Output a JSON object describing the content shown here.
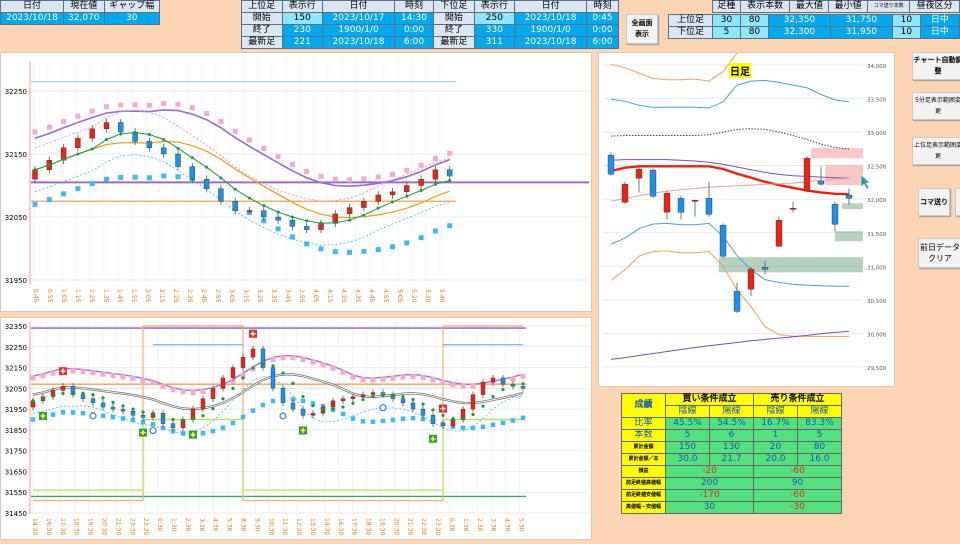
{
  "summary": {
    "headers": [
      "日付",
      "現在値",
      "ギャップ幅"
    ],
    "values": [
      "2023/10/18",
      "32,070",
      "30"
    ]
  },
  "range_table": {
    "headers": [
      "上位足",
      "表示行",
      "日付",
      "時刻",
      "下位足",
      "表示行",
      "日付",
      "時刻"
    ],
    "rows": [
      [
        "開始",
        "150",
        "2023/10/17",
        "14:30",
        "開始",
        "250",
        "2023/10/18",
        "0:45"
      ],
      [
        "終了",
        "230",
        "1900/1/0",
        "0:00",
        "終了",
        "330",
        "1900/1/0",
        "0:00"
      ],
      [
        "最新足",
        "221",
        "2023/10/18",
        "6:00",
        "最新足",
        "311",
        "2023/10/18",
        "6:00"
      ]
    ]
  },
  "fullscreen_button": [
    "全画面",
    "表示"
  ],
  "timeframe_table": {
    "headers": [
      "",
      "足種",
      "表示本数",
      "最大値",
      "最小値",
      "コマ送り本数",
      "昼夜区分"
    ],
    "rows": [
      [
        "上位足",
        "30",
        "80",
        "32,350",
        "31,750",
        "10",
        "日中"
      ],
      [
        "下位足",
        "5",
        "80",
        "32,300",
        "31,950",
        "10",
        "日中"
      ]
    ]
  },
  "buttons": {
    "auto_adjust": "チャート自動調整",
    "lower_range": "5分足表示範囲変更",
    "upper_range": "上位足表示範囲変更",
    "step": "コマ送り",
    "clear_line1": "前日データ",
    "clear_line2": "クリア"
  },
  "stats": {
    "title": "成績",
    "buy_header": "買い条件成立",
    "sell_header": "売り条件成立",
    "sub": [
      "陰線",
      "陽線",
      "陰線",
      "陽線"
    ],
    "rows": [
      {
        "label": "比率",
        "cells": [
          "45.5%",
          "54.5%",
          "16.7%",
          "83.3%"
        ]
      },
      {
        "label": "本数",
        "cells": [
          "5",
          "6",
          "1",
          "5"
        ]
      },
      {
        "label": "累計金額",
        "cells": [
          "150",
          "130",
          "20",
          "80"
        ]
      },
      {
        "label": "累計金額／本",
        "cells": [
          "30.0",
          "21.7",
          "20.0",
          "16.0"
        ]
      }
    ],
    "merged_rows": [
      {
        "label": "損益",
        "buy": "-20",
        "sell": "-60"
      },
      {
        "label": "前足終値高値幅",
        "buy": "200",
        "sell": "90"
      },
      {
        "label": "前足終値安値幅",
        "buy": "-170",
        "sell": "-60"
      },
      {
        "label": "高値幅－安値幅",
        "buy": "30",
        "sell": "-30"
      }
    ]
  },
  "colors": {
    "up": "#e8231a",
    "down": "#1e90e6",
    "peach": "#fcd5b4",
    "accent_blue": "#00a8ee"
  },
  "chart_data": [
    {
      "type": "candlestick",
      "name": "5min-zoomed",
      "yticks": [
        "32250",
        "32150",
        "32050",
        "31950"
      ],
      "ylim": [
        31950,
        32250
      ],
      "xticks": [
        "0:45",
        "0:55",
        "1:05",
        "1:15",
        "1:25",
        "1:35",
        "1:45",
        "1:55",
        "2:05",
        "2:15",
        "2:25",
        "2:35",
        "2:45",
        "2:55",
        "3:05",
        "3:15",
        "3:25",
        "3:35",
        "3:45",
        "3:55",
        "4:05",
        "4:15",
        "4:25",
        "4:35",
        "4:45",
        "4:55",
        "5:05",
        "5:20",
        "5:30",
        "5:40"
      ],
      "first_open": 32110,
      "closes": [
        32125,
        32140,
        32160,
        32175,
        32190,
        32200,
        32185,
        32170,
        32160,
        32150,
        32130,
        32110,
        32095,
        32075,
        32060,
        32060,
        32050,
        32045,
        32035,
        32030,
        32040,
        32055,
        32065,
        32075,
        32085,
        32090,
        32100,
        32110,
        32125,
        32115
      ],
      "wick": 10,
      "band_upper_offset": 60,
      "band_lower_offset": 55,
      "hlines": [
        {
          "price": 32265,
          "color": "#9ccaf0"
        },
        {
          "price": 32105,
          "color": "#9a6cc8"
        },
        {
          "price": 32075,
          "color": "#f0a050"
        }
      ]
    },
    {
      "type": "candlestick",
      "name": "5min-full",
      "yticks": [
        "32350",
        "32250",
        "32150",
        "32050",
        "31950",
        "31850",
        "31750",
        "31650",
        "31550",
        "31450"
      ],
      "ylim": [
        31450,
        32350
      ],
      "xticks": [
        "14:30",
        "16:30",
        "17:30",
        "18:30",
        "19:30",
        "20:30",
        "21:30",
        "22:30",
        "23:30",
        "0:30",
        "1:30",
        "2:30",
        "3:30",
        "4:30",
        "5:30",
        "8:30",
        "9:30",
        "10:30",
        "11:30",
        "12:30",
        "13:30",
        "14:30",
        "16:30",
        "17:30",
        "18:30",
        "19:30",
        "20:30",
        "21:30",
        "22:30",
        "23:30",
        "0:30",
        "1:30",
        "2:30",
        "3:30",
        "4:30",
        "5:30"
      ],
      "first_open": 31960,
      "closes": [
        31990,
        32010,
        32040,
        32060,
        32020,
        32000,
        31980,
        31960,
        31950,
        31940,
        31920,
        31910,
        31930,
        31880,
        31860,
        31900,
        31950,
        32000,
        32050,
        32100,
        32150,
        32200,
        32240,
        32150,
        32050,
        31980,
        31950,
        31920,
        31930,
        31960,
        31990,
        32000,
        32010,
        32020,
        32030,
        32020,
        32000,
        31980,
        31950,
        31920,
        31880,
        31870,
        31900,
        31950,
        32020,
        32080,
        32100,
        32070,
        32060,
        32050
      ],
      "wick": 25,
      "band_upper_offset": 110,
      "band_lower_offset": 90,
      "hlines": [
        {
          "price": 32340,
          "color": "#8a5cc0"
        },
        {
          "price": 31530,
          "color": "#3aa860"
        },
        {
          "price": 32070,
          "color": "#f0a050"
        }
      ],
      "steps": [
        {
          "color": "#f0b080",
          "segments": [
            [
              0,
              11,
              31510
            ],
            [
              11,
              21,
              32350
            ],
            [
              21,
              41,
              31510
            ],
            [
              41,
              49,
              32350
            ]
          ]
        },
        {
          "color": "#b8e070",
          "segments": [
            [
              0,
              11,
              31560
            ],
            [
              11,
              21,
              31900
            ],
            [
              21,
              41,
              31560
            ],
            [
              41,
              49,
              31900
            ]
          ]
        },
        {
          "color": "#80b8f0",
          "segments": [
            [
              12,
              21,
              32260
            ],
            [
              41,
              49,
              32260
            ]
          ]
        }
      ],
      "markers": [
        {
          "i": 3,
          "type": "sell"
        },
        {
          "i": 22,
          "type": "sell"
        },
        {
          "i": 41,
          "type": "sell"
        },
        {
          "i": 1,
          "type": "buy"
        },
        {
          "i": 11,
          "type": "buy"
        },
        {
          "i": 16,
          "type": "buy"
        },
        {
          "i": 27,
          "type": "buy"
        },
        {
          "i": 40,
          "type": "buy"
        },
        {
          "i": 6,
          "type": "circle"
        },
        {
          "i": 12,
          "type": "circle"
        },
        {
          "i": 25,
          "type": "circle"
        },
        {
          "i": 35,
          "type": "circle"
        }
      ]
    },
    {
      "type": "candlestick",
      "name": "daily",
      "title": "日足",
      "yticks": [
        "34,000",
        "33,500",
        "33,000",
        "32,500",
        "32,000",
        "31,500",
        "31,000",
        "30,500",
        "30,000",
        "29,500"
      ],
      "ylim": [
        29500,
        34000
      ],
      "ohlc": [
        [
          32657,
          32700,
          32350,
          32373
        ],
        [
          31955,
          32260,
          31930,
          32224
        ],
        [
          32313,
          32470,
          32100,
          32448
        ],
        [
          32433,
          32460,
          32020,
          32045
        ],
        [
          31806,
          32120,
          31700,
          32090
        ],
        [
          32015,
          32050,
          31700,
          31806
        ],
        [
          31985,
          31990,
          31740,
          31985
        ],
        [
          32015,
          32260,
          31740,
          31776
        ],
        [
          31612,
          31640,
          31120,
          31149
        ],
        [
          30627,
          30760,
          30300,
          30328
        ],
        [
          30657,
          30990,
          30560,
          30955
        ],
        [
          30985,
          31080,
          30880,
          30955
        ],
        [
          31299,
          31740,
          31290,
          31687
        ],
        [
          31866,
          31960,
          31800,
          31866
        ],
        [
          32119,
          32640,
          32110,
          32612
        ],
        [
          32269,
          32490,
          32200,
          32224
        ],
        [
          31925,
          31960,
          31520,
          31627
        ],
        [
          32060,
          32160,
          31920,
          32015
        ]
      ],
      "lines": [
        {
          "name": "bb-upper2",
          "color": "#f0a060",
          "values": [
            34010,
            33960,
            33880,
            33800,
            33780,
            33780,
            33790,
            33760,
            33900,
            34200
          ]
        },
        {
          "name": "bb-upper1",
          "color": "#4aa0c8",
          "values": [
            33490,
            33460,
            33400,
            33370,
            33370,
            33370,
            33370,
            33360,
            33450,
            33700,
            33760,
            33770,
            33740,
            33700,
            33660,
            33560,
            33480,
            33450
          ]
        },
        {
          "name": "mid-dotted",
          "color": "#444",
          "values": [
            32940,
            32950,
            32950,
            32950,
            32950,
            32950,
            32950,
            32960,
            33000,
            33040,
            33050,
            33040,
            33000,
            32950,
            32890,
            32820,
            32770,
            32750
          ]
        },
        {
          "name": "ma-red",
          "color": "#f02010",
          "values": [
            32420,
            32470,
            32490,
            32490,
            32490,
            32490,
            32490,
            32490,
            32450,
            32380,
            32320,
            32260,
            32210,
            32170,
            32130,
            32100,
            32080,
            32075
          ]
        },
        {
          "name": "ma-purple",
          "color": "#7a50b0",
          "values": [
            32580,
            32590,
            32590,
            32590,
            32590,
            32580,
            32570,
            32550,
            32520,
            32480,
            32440,
            32400,
            32370,
            32350,
            32340,
            32330,
            32320,
            32313
          ]
        },
        {
          "name": "ma-pink",
          "color": "#e8a0a0",
          "values": [
            31970,
            32010,
            32050,
            32090,
            32120,
            32140,
            32160,
            32180,
            32190,
            32200,
            32210,
            32220,
            32230,
            32240,
            32260,
            32280,
            32300,
            32313
          ]
        },
        {
          "name": "bb-lower1",
          "color": "#4aa0c8",
          "values": [
            31330,
            31420,
            31560,
            31630,
            31640,
            31620,
            31620,
            31640,
            31450,
            31160,
            30950,
            30800,
            30760,
            30730,
            30720,
            30710,
            30705,
            30700
          ]
        },
        {
          "name": "bb-lower2",
          "color": "#f0a060",
          "values": [
            30790,
            30950,
            31150,
            31220,
            31230,
            31200,
            31200,
            31220,
            31000,
            30650,
            30400,
            30100,
            29980,
            29960,
            29955,
            29955,
            29955,
            29955
          ]
        },
        {
          "name": "long-purple",
          "color": "#7a50b0",
          "values": [
            29612,
            29640,
            29670,
            29700,
            29730,
            29760,
            29790,
            29815,
            29840,
            29865,
            29890,
            29910,
            29930,
            29950,
            29970,
            29995,
            30015,
            30030
          ]
        }
      ],
      "zones": [
        {
          "from": 14.3,
          "to": 18,
          "low": 32612,
          "high": 32761,
          "color": "#f08080"
        },
        {
          "from": 15.3,
          "to": 18,
          "low": 32209,
          "high": 32508,
          "color": "#f08080"
        },
        {
          "from": 16.5,
          "to": 18,
          "low": 31851,
          "high": 31940,
          "color": "#5a9a70"
        },
        {
          "from": 16,
          "to": 18,
          "low": 31373,
          "high": 31523,
          "color": "#5a9a70"
        },
        {
          "from": 7.7,
          "to": 18,
          "low": 30910,
          "high": 31135,
          "color": "#5a9a70"
        }
      ]
    }
  ]
}
